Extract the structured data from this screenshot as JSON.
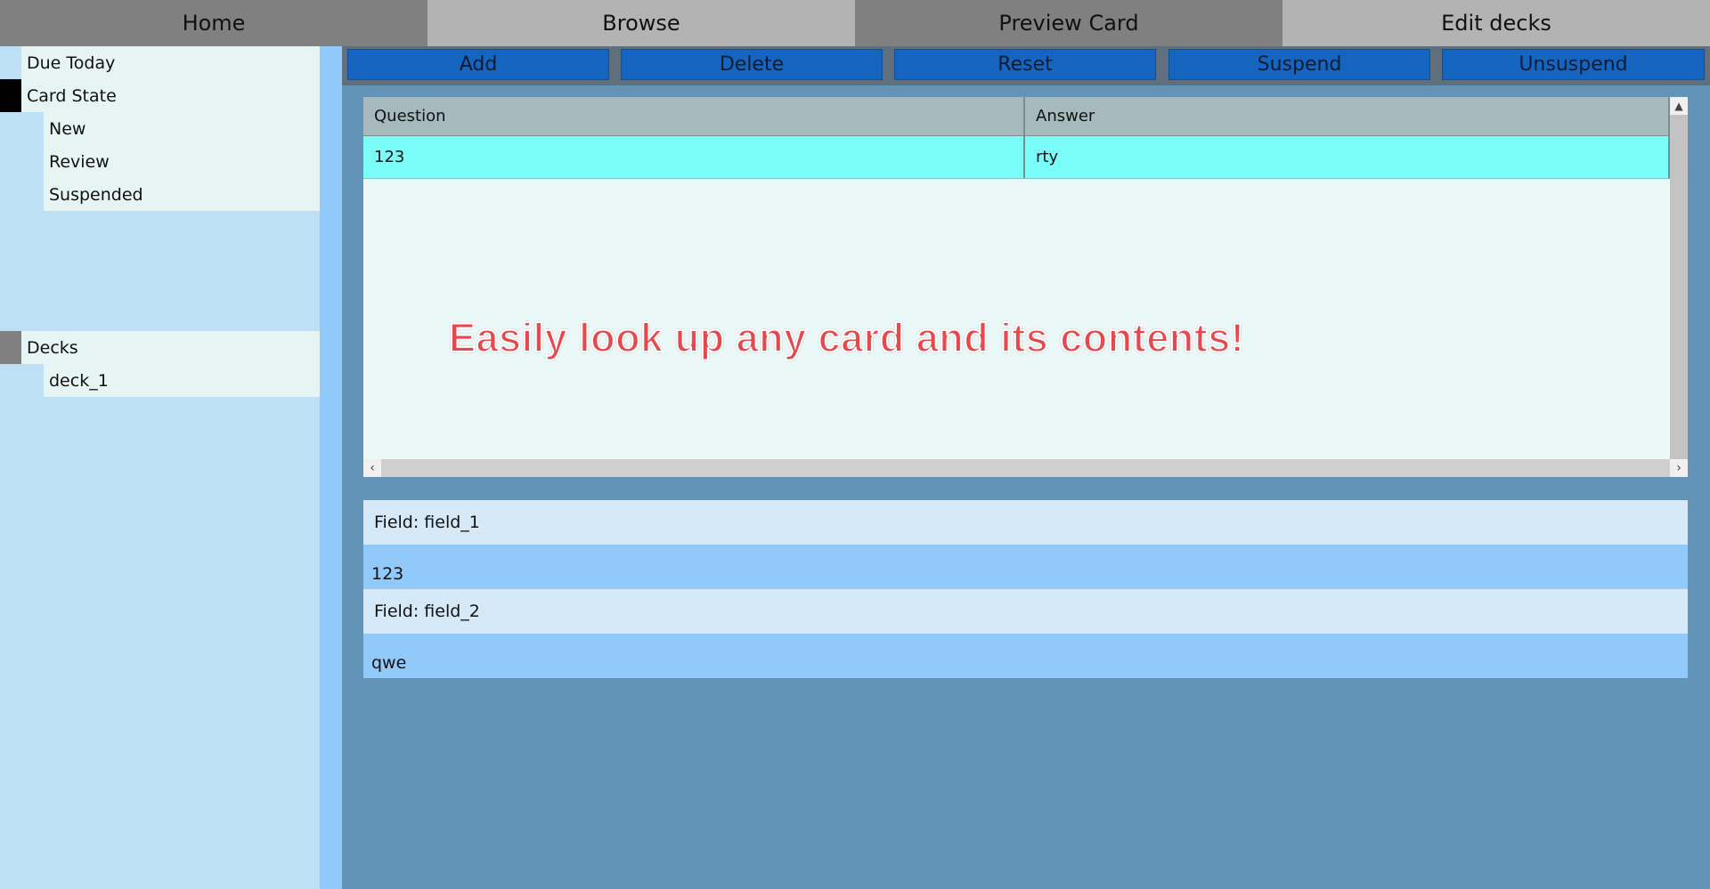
{
  "nav": {
    "tabs": [
      {
        "label": "Home"
      },
      {
        "label": "Browse"
      },
      {
        "label": "Preview Card"
      },
      {
        "label": "Edit decks"
      }
    ]
  },
  "sidebar": {
    "due_today": "Due Today",
    "card_state": "Card State",
    "states": [
      "New",
      "Review",
      "Suspended"
    ],
    "decks": "Decks",
    "deck_items": [
      "deck_1"
    ]
  },
  "toolbar": {
    "add": "Add",
    "delete": "Delete",
    "reset": "Reset",
    "suspend": "Suspend",
    "unsuspend": "Unsuspend"
  },
  "grid": {
    "columns": [
      "Question",
      "Answer"
    ],
    "rows": [
      {
        "question": "123",
        "answer": "rty"
      }
    ]
  },
  "overlay_caption": "Easily look up any card and its contents!",
  "fields": [
    {
      "label": "Field: field_1",
      "value": "123"
    },
    {
      "label": "Field: field_2",
      "value": "qwe"
    }
  ],
  "colors": {
    "toolbar_button": "#1565c0",
    "selected_row": "#7afdf8",
    "sidebar_bg": "#bde0f7",
    "main_bg": "#6394b8"
  }
}
